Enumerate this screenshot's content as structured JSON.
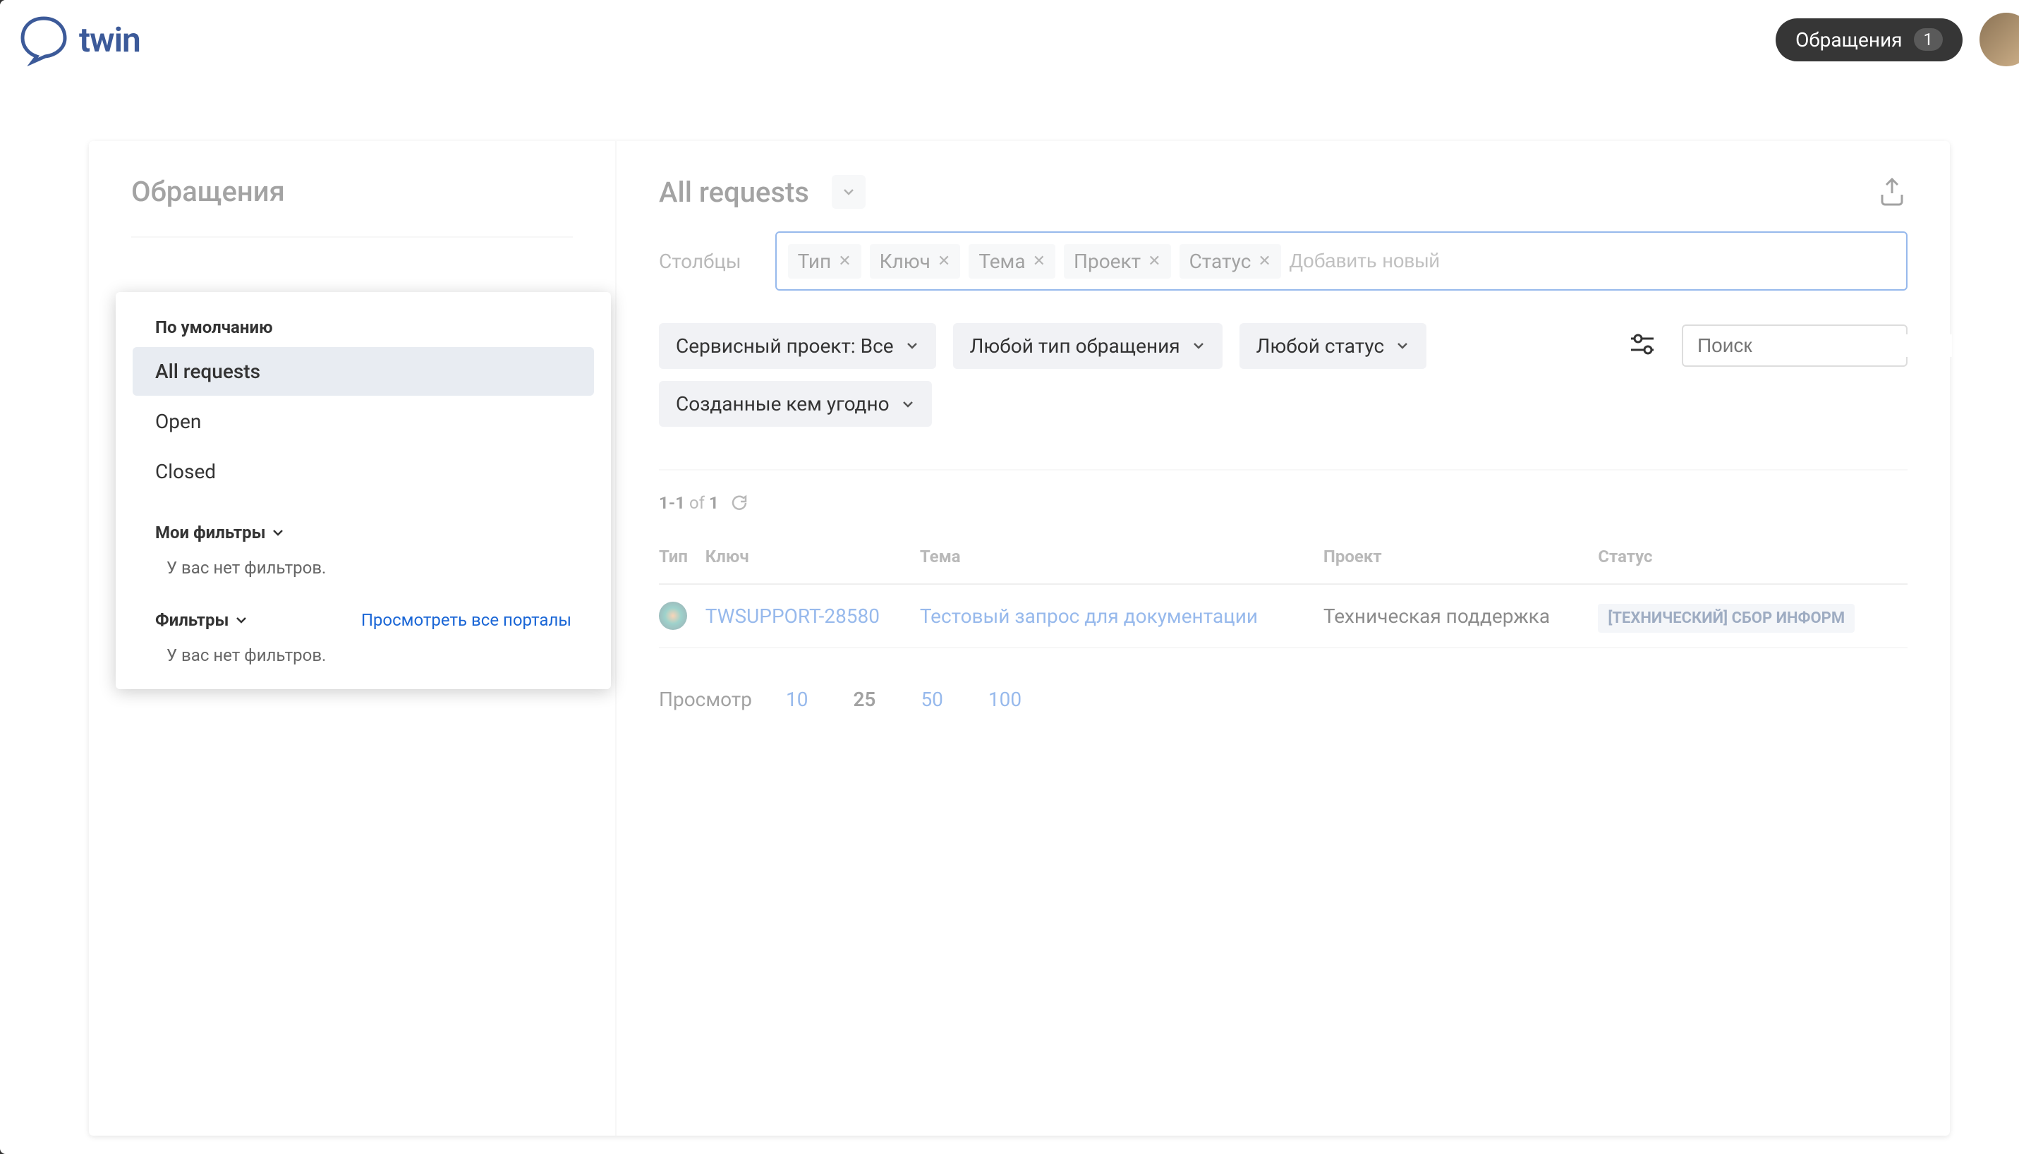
{
  "brand": {
    "name": "twin"
  },
  "topbar": {
    "requests_label": "Обращения",
    "badge_count": "1"
  },
  "sidebar": {
    "title": "Обращения"
  },
  "popup": {
    "default_header": "По умолчанию",
    "items": [
      "All requests",
      "Open",
      "Closed"
    ],
    "my_filters_header": "Мои фильтры",
    "empty1": "У вас нет фильтров.",
    "filters_header": "Фильтры",
    "view_all_link": "Просмотреть все порталы",
    "empty2": "У вас нет фильтров."
  },
  "content": {
    "title": "All requests",
    "columns_label": "Столбцы",
    "tags": [
      "Тип",
      "Ключ",
      "Тема",
      "Проект",
      "Статус"
    ],
    "tags_placeholder": "Добавить новый",
    "filters": {
      "project": "Сервисный проект: Все",
      "type": "Любой тип обращения",
      "status": "Любой статус",
      "creator": "Созданные кем угодно"
    },
    "search_placeholder": "Поиск",
    "count_prefix": "1-1",
    "count_of": "of",
    "count_total": "1",
    "table": {
      "headers": {
        "type": "Тип",
        "key": "Ключ",
        "topic": "Тема",
        "project": "Проект",
        "status": "Статус"
      },
      "row": {
        "key": "TWSUPPORT-28580",
        "topic": "Тестовый запрос для документации",
        "project": "Техническая поддержка",
        "status": "[ТЕХНИЧЕСКИЙ] СБОР ИНФОРМ"
      }
    },
    "pager": {
      "label": "Просмотр",
      "options": [
        "10",
        "25",
        "50",
        "100"
      ]
    }
  }
}
